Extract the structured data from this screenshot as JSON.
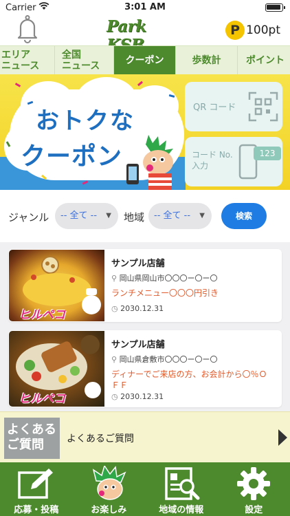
{
  "status": {
    "carrier": "Carrier",
    "time": "3:01 AM"
  },
  "header": {
    "logo_text": "Park KSB",
    "points_badge": "P",
    "points_value": "100pt"
  },
  "tabs": [
    {
      "label": "エリア\nニュース"
    },
    {
      "label": "全国\nニュース"
    },
    {
      "label": "クーポン"
    },
    {
      "label": "歩数計"
    },
    {
      "label": "ポイント"
    }
  ],
  "banner": {
    "title_line1": "おトクな",
    "title_line2": "クーポン",
    "qr_label": "QR コード",
    "code_label_1": "コード No.",
    "code_label_2": "入力",
    "code_number": "123"
  },
  "filter": {
    "genre_label": "ジャンル",
    "genre_value": "-- 全て --",
    "area_label": "地域",
    "area_value": "-- 全て --",
    "search_label": "検索"
  },
  "coupons": [
    {
      "name": "サンプル店舗",
      "address": "岡山県岡山市〇〇〇ー〇ー〇",
      "description": "ランチメニュー〇〇〇円引き",
      "date": "2030.12.31",
      "brand": "ヒルペコ"
    },
    {
      "name": "サンプル店舗",
      "address": "岡山県倉敷市〇〇〇ー〇ー〇",
      "description": "ディナーでご来店の方、お会計から〇％ＯＦＦ",
      "date": "2030.12.31",
      "brand": "ヒルペコ"
    }
  ],
  "faq": {
    "icon_line1": "よくある",
    "icon_line2": "ご質問",
    "label": "よくあるご質問"
  },
  "bottom_nav": [
    {
      "label": "応募・投稿",
      "icon": "pencil-icon"
    },
    {
      "label": "お楽しみ",
      "icon": "mascot-icon"
    },
    {
      "label": "地域の情報",
      "icon": "newspaper-icon"
    },
    {
      "label": "設定",
      "icon": "gear-icon"
    }
  ],
  "colors": {
    "brand_green": "#4d8a2e",
    "tab_bg": "#e9f2d8",
    "accent_blue": "#1f7ce3",
    "coupon_text": "#e05a2b",
    "points_gold": "#f5c400"
  }
}
